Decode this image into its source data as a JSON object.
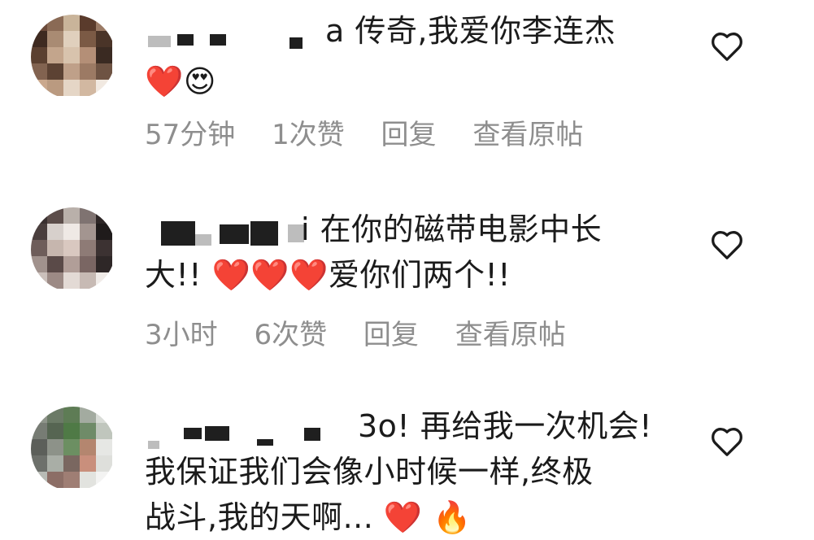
{
  "comments": [
    {
      "text_line1": "a 传奇,我爱你李连杰",
      "text_line2": "❤️😍",
      "time": "57分钟",
      "likes": "1次赞",
      "reply": "回复",
      "view_post": "查看原帖"
    },
    {
      "text_line1": "i 在你的磁带电影中长",
      "text_line2": "大!! ❤️❤️❤️爱你们两个!!",
      "time": "3小时",
      "likes": "6次赞",
      "reply": "回复",
      "view_post": "查看原帖"
    },
    {
      "text_line1": "3o! 再给我一次机会!",
      "text_line2": "我保证我们会像小时候一样,终极",
      "text_line3": "战斗,我的天啊... ❤️ 🔥"
    }
  ],
  "colors": {
    "text": "#1b1b1b",
    "meta": "#8e8e8e",
    "heart_outline": "#1b1b1b"
  },
  "icons": {
    "like": "heart-outline-icon"
  }
}
